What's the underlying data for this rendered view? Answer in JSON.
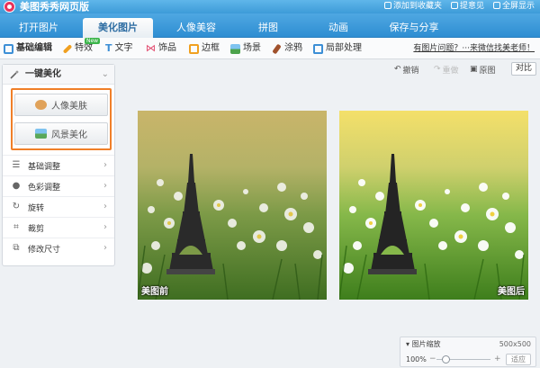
{
  "app": {
    "title": "美图秀秀网页版",
    "links": {
      "favorite": "添加到收藏夹",
      "feedback": "提意见",
      "fullscreen": "全屏显示"
    }
  },
  "tabs": [
    {
      "label": "打开图片",
      "active": false
    },
    {
      "label": "美化图片",
      "active": true
    },
    {
      "label": "人像美容",
      "active": false
    },
    {
      "label": "拼图",
      "active": false
    },
    {
      "label": "动画",
      "active": false
    },
    {
      "label": "保存与分享",
      "active": false
    }
  ],
  "toolbar": {
    "items": [
      {
        "label": "基础编辑",
        "icon": "basic-edit-icon",
        "color": "#3d8fd6"
      },
      {
        "label": "特效",
        "icon": "magic-wand-icon",
        "color": "#f0a020",
        "badge": "New"
      },
      {
        "label": "文字",
        "icon": "text-icon",
        "color": "#3d8fd6"
      },
      {
        "label": "饰品",
        "icon": "bow-icon",
        "color": "#e2456a"
      },
      {
        "label": "边框",
        "icon": "frame-icon",
        "color": "#f0a020"
      },
      {
        "label": "场景",
        "icon": "scene-icon",
        "color": "#4ca34c"
      },
      {
        "label": "涂鸦",
        "icon": "brush-icon",
        "color": "#a0522d"
      },
      {
        "label": "局部处理",
        "icon": "local-edit-icon",
        "color": "#3d8fd6"
      }
    ],
    "help_link": "有图片问题？···来微信找美老师！"
  },
  "sidebar": {
    "header": "一键美化",
    "buttons": [
      {
        "label": "人像美肤",
        "icon": "portrait-icon"
      },
      {
        "label": "风景美化",
        "icon": "landscape-icon"
      }
    ],
    "items": [
      {
        "label": "基础调整",
        "icon": "sliders-icon"
      },
      {
        "label": "色彩调整",
        "icon": "palette-icon"
      },
      {
        "label": "旋转",
        "icon": "rotate-icon"
      },
      {
        "label": "裁剪",
        "icon": "crop-icon"
      },
      {
        "label": "修改尺寸",
        "icon": "resize-icon"
      }
    ]
  },
  "actions": {
    "undo": "撤销",
    "redo": "重做",
    "original": "原图",
    "compare": "对比"
  },
  "images": {
    "before_caption": "美图前",
    "after_caption": "美图后"
  },
  "zoom": {
    "title": "图片缩放",
    "size": "500x500",
    "percent": "100%",
    "level": 0.17,
    "fit_label": "适应"
  }
}
